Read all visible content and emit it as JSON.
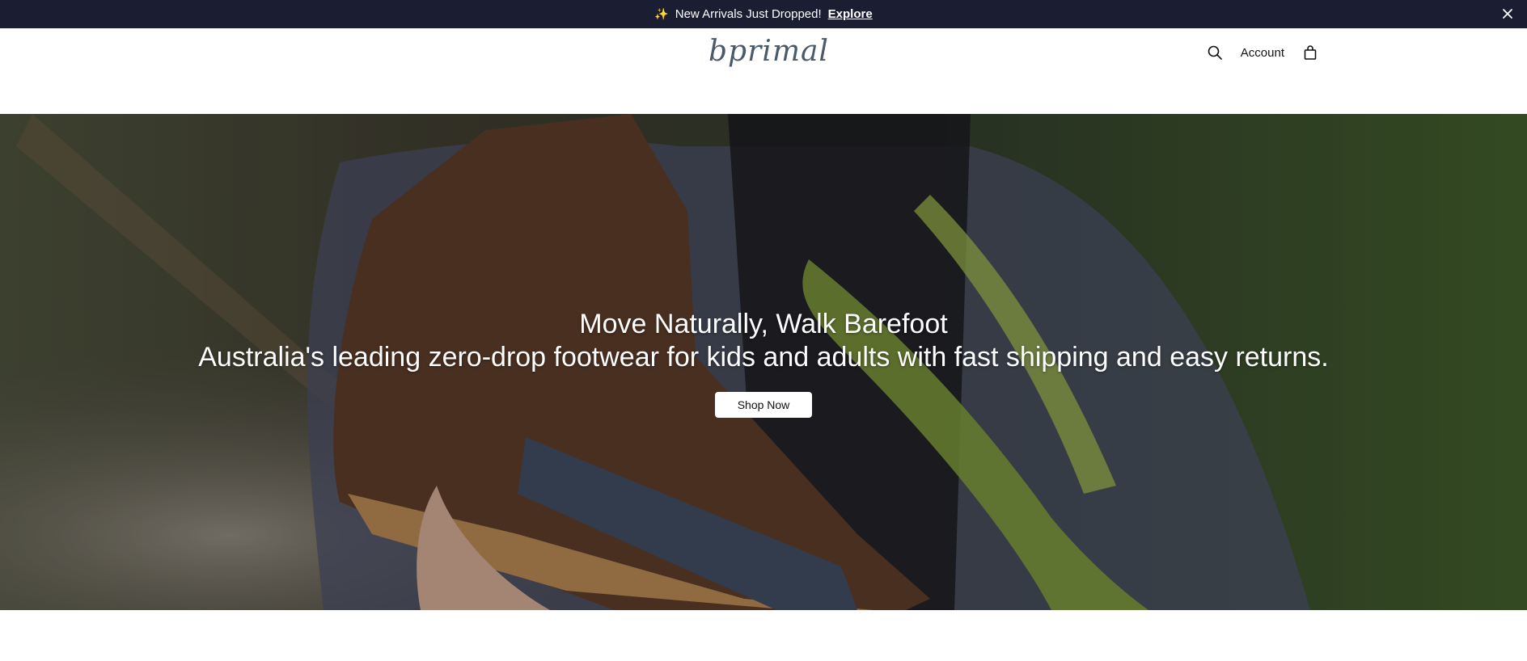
{
  "announcement": {
    "spark_icon": "sparkle-icon",
    "text": "New Arrivals Just Dropped!",
    "link_label": "Explore",
    "close_icon": "close-icon"
  },
  "header": {
    "logo_text": "bprimal",
    "search_icon": "search-icon",
    "account_label": "Account",
    "cart_icon": "shopping-bag-icon"
  },
  "hero": {
    "title": "Move Naturally, Walk Barefoot",
    "subtitle": "Australia's leading zero-drop footwear for kids and adults with fast shipping and easy returns.",
    "button_label": "Shop Now"
  },
  "colors": {
    "announcement_bg": "#1b1d33",
    "logo": "#4a5a6a",
    "hero_button_bg": "#ffffff"
  }
}
